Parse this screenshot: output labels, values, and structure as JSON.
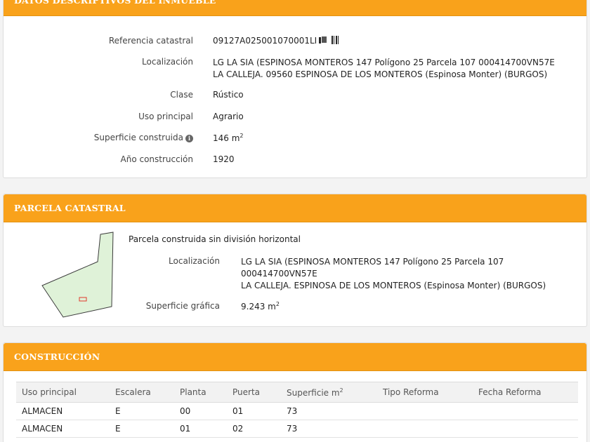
{
  "inmueble": {
    "title": "DATOS DESCRIPTIVOS DEL INMUEBLE",
    "referencia_label": "Referencia catastral",
    "referencia_value": "09127A025001070001LI",
    "localizacion_label": "Localización",
    "localizacion_line1": "LG LA SIA (ESPINOSA MONTEROS 147 Polígono 25 Parcela 107 000414700VN57E",
    "localizacion_line2": "LA CALLEJA. 09560 ESPINOSA DE LOS MONTEROS (Espinosa Monter) (BURGOS)",
    "clase_label": "Clase",
    "clase_value": "Rústico",
    "uso_label": "Uso principal",
    "uso_value": "Agrario",
    "superficie_label": "Superficie construida",
    "superficie_value": "146 m",
    "superficie_sup": "2",
    "anio_label": "Año construcción",
    "anio_value": "1920"
  },
  "parcela": {
    "title": "PARCELA CATASTRAL",
    "subtitle": "Parcela construida sin división horizontal",
    "localizacion_label": "Localización",
    "localizacion_line1": "LG LA SIA (ESPINOSA MONTEROS 147 Polígono 25 Parcela 107",
    "localizacion_line2": "000414700VN57E",
    "localizacion_line3": "LA CALLEJA. ESPINOSA DE LOS MONTEROS (Espinosa Monter) (BURGOS)",
    "superficie_label": "Superficie gráfica",
    "superficie_value": "9.243 m",
    "superficie_sup": "2",
    "colors": {
      "fill": "#dff2d8",
      "stroke": "#3a3a3a",
      "building": "#e0392b"
    }
  },
  "construccion": {
    "title": "CONSTRUCCIÓN",
    "headers": [
      "Uso principal",
      "Escalera",
      "Planta",
      "Puerta",
      "Superficie m",
      "Tipo Reforma",
      "Fecha Reforma"
    ],
    "superficie_sup": "2",
    "rows": [
      [
        "ALMACEN",
        "E",
        "00",
        "01",
        "73",
        "",
        ""
      ],
      [
        "ALMACEN",
        "E",
        "01",
        "02",
        "73",
        "",
        ""
      ]
    ]
  },
  "colors": {
    "accent": "#f9a21b",
    "panel_bg": "#ffffff",
    "page_bg": "#f3f3f3"
  },
  "icons": [
    "copy-icon",
    "barcode-icon",
    "info-icon"
  ]
}
